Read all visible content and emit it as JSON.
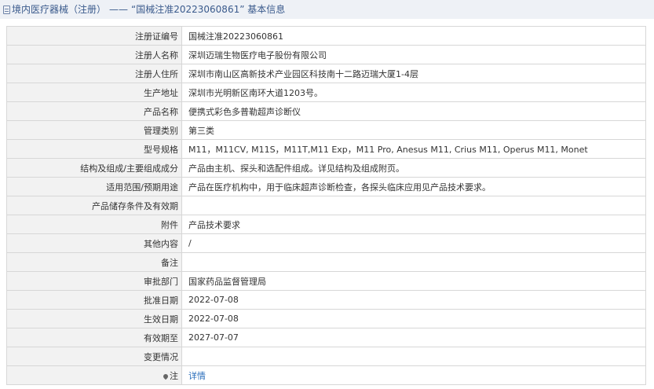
{
  "header": {
    "section": "境内医疗器械（注册）",
    "separator": "——",
    "title": "“国械注准20223060861” 基本信息"
  },
  "rows": [
    {
      "label": "注册证编号",
      "value": "国械注准20223060861"
    },
    {
      "label": "注册人名称",
      "value": "深圳迈瑞生物医疗电子股份有限公司"
    },
    {
      "label": "注册人住所",
      "value": "深圳市南山区高新技术产业园区科技南十二路迈瑞大厦1-4层"
    },
    {
      "label": "生产地址",
      "value": "深圳市光明新区南环大道1203号。"
    },
    {
      "label": "产品名称",
      "value": "便携式彩色多普勒超声诊断仪"
    },
    {
      "label": "管理类别",
      "value": "第三类"
    },
    {
      "label": "型号规格",
      "value": "M11，M11CV, M11S，M11T,M11 Exp，M11 Pro, Anesus M11, Crius M11, Operus M11, Monet"
    },
    {
      "label": "结构及组成/主要组成成分",
      "value": "产品由主机、探头和选配件组成。详见结构及组成附页。"
    },
    {
      "label": "适用范围/预期用途",
      "value": "产品在医疗机构中，用于临床超声诊断检查，各探头临床应用见产品技术要求。"
    },
    {
      "label": "产品储存条件及有效期",
      "value": ""
    },
    {
      "label": "附件",
      "value": "产品技术要求"
    },
    {
      "label": "其他内容",
      "value": "/"
    },
    {
      "label": "备注",
      "value": ""
    },
    {
      "label": "审批部门",
      "value": "国家药品监督管理局"
    },
    {
      "label": "批准日期",
      "value": "2022-07-08"
    },
    {
      "label": "生效日期",
      "value": "2022-07-08"
    },
    {
      "label": "有效期至",
      "value": "2027-07-07"
    },
    {
      "label": "变更情况",
      "value": ""
    }
  ],
  "footer_row": {
    "label": "注",
    "link": "详情"
  },
  "colors": {
    "link": "#2a6ebb",
    "label_bg": "#f2f2f2",
    "header_bg": "#eef1f6"
  }
}
